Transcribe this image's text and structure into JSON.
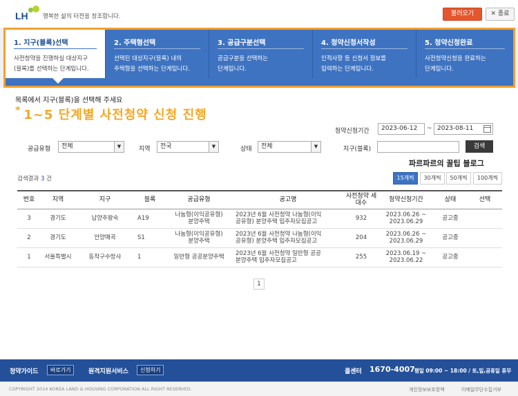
{
  "header": {
    "slogan": "행복한 삶의 터전을 창조합니다.",
    "logo_text": "LH",
    "load_button": "불러오기",
    "close_button": "✕ 종료"
  },
  "steps": [
    {
      "title": "1. 지구(블록)선택",
      "desc1": "사전청약을 진행하실 대상지구",
      "desc2": "(블록)를 선택하는 단계입니다."
    },
    {
      "title": "2. 주택형선택",
      "desc1": "선택된 대상지구(블록) 내의",
      "desc2": "주택형을 선택하는 단계입니다."
    },
    {
      "title": "3. 공급구분선택",
      "desc1": "공급구분을 선택하는",
      "desc2": "단계입니다."
    },
    {
      "title": "4. 청약신청서작성",
      "desc1": "인적사항 등 신청서 정보를",
      "desc2": "입력하는 단계입니다."
    },
    {
      "title": "5. 청약신청완료",
      "desc1": "사전청약신청을 완료하는",
      "desc2": "단계입니다."
    }
  ],
  "intro": "목록에서 지구(블록)을 선택해 주세요",
  "overlay_caption": "1~5 단계별 사전청약 신청 진행",
  "overlay_star": "*",
  "filters": {
    "period_label": "청약신청기간",
    "date_from": "2023-06-12",
    "date_sep": "~",
    "date_to": "2023-08-11",
    "supply_type_label": "공급유형",
    "supply_type_value": "전체",
    "region_label": "지역",
    "region_value": "전국",
    "status_label": "상태",
    "status_value": "전체",
    "district_label": "지구(블록)",
    "district_value": "",
    "search_button": "검색"
  },
  "watermark": "파르파르의 꿀팁 블로그",
  "results": {
    "prefix": "검색결과",
    "count": "3",
    "suffix": "건",
    "page_sizes": [
      "15개씩",
      "30개씩",
      "50개씩",
      "100개씩"
    ]
  },
  "table": {
    "headers": [
      "번호",
      "지역",
      "지구",
      "블록",
      "공급유형",
      "공고명",
      "사전청약 세대수",
      "청약신청기간",
      "상태",
      "선택"
    ],
    "rows": [
      {
        "no": "3",
        "region": "경기도",
        "district": "남양주왕숙",
        "block": "A19",
        "type1": "나눔형(이익공유형)",
        "type2": "분양주택",
        "notice1": "2023년 6월 사전청약 나눔형(이익",
        "notice2": "공유형) 분양주택 입주자모집공고",
        "units": "932",
        "period1": "2023.06.26 ~",
        "period2": "2023.06.29",
        "status": "공고중"
      },
      {
        "no": "2",
        "region": "경기도",
        "district": "안양매곡",
        "block": "S1",
        "type1": "나눔형(이익공유형)",
        "type2": "분양주택",
        "notice1": "2023년 6월 사전청약 나눔형(이익",
        "notice2": "공유형) 분양주택 입주자모집공고",
        "units": "204",
        "period1": "2023.06.26 ~",
        "period2": "2023.06.29",
        "status": "공고중"
      },
      {
        "no": "1",
        "region": "서울특별시",
        "district": "동작구수방사",
        "block": "1",
        "type1": "일반형 공공분양주택",
        "type2": "",
        "notice1": "2023년 6월 사전청약 일반형 공공",
        "notice2": "분양주택 입주자모집공고",
        "units": "255",
        "period1": "2023.06.19 ~",
        "period2": "2023.06.22",
        "status": "공고중"
      }
    ]
  },
  "pagination": {
    "current": "1"
  },
  "footer": {
    "guide_label": "청약가이드",
    "guide_button": "바로가기",
    "remote_label": "원격지원서비스",
    "remote_button": "신청하기",
    "call_label": "콜센터",
    "call_number": "1670-4007",
    "hours": "평일 09:00 ~ 18:00 / 토,일,공휴일 휴무"
  },
  "copyright": {
    "text": "COPYRIGHT 2014 KOREA LAND & HOUSING CORPORATION ALL RIGHT RESERVED.",
    "privacy": "개인정보보호정책",
    "email": "이메일무단수집거부"
  }
}
